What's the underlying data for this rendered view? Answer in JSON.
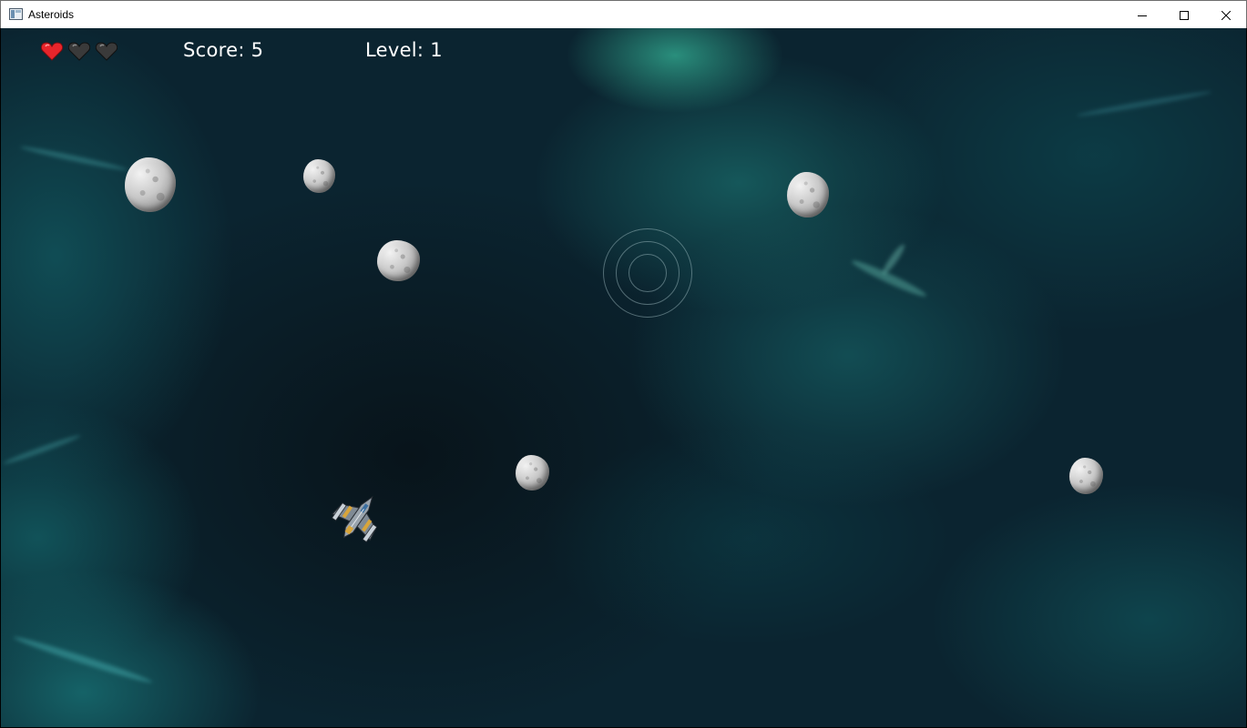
{
  "window": {
    "title": "Asteroids",
    "controls": [
      "minimize",
      "maximize",
      "close"
    ]
  },
  "hud": {
    "lives": {
      "total": 3,
      "remaining": 1
    },
    "score_label": "Score: 5",
    "level_label": "Level: 1"
  },
  "colors": {
    "heart_full": "#e8252b",
    "heart_empty": "#3a3a3a",
    "hud_text": "#ffffff"
  },
  "icons": [
    "app-icon",
    "minimize-icon",
    "maximize-icon",
    "close-icon",
    "heart-icon",
    "spaceship-icon"
  ]
}
